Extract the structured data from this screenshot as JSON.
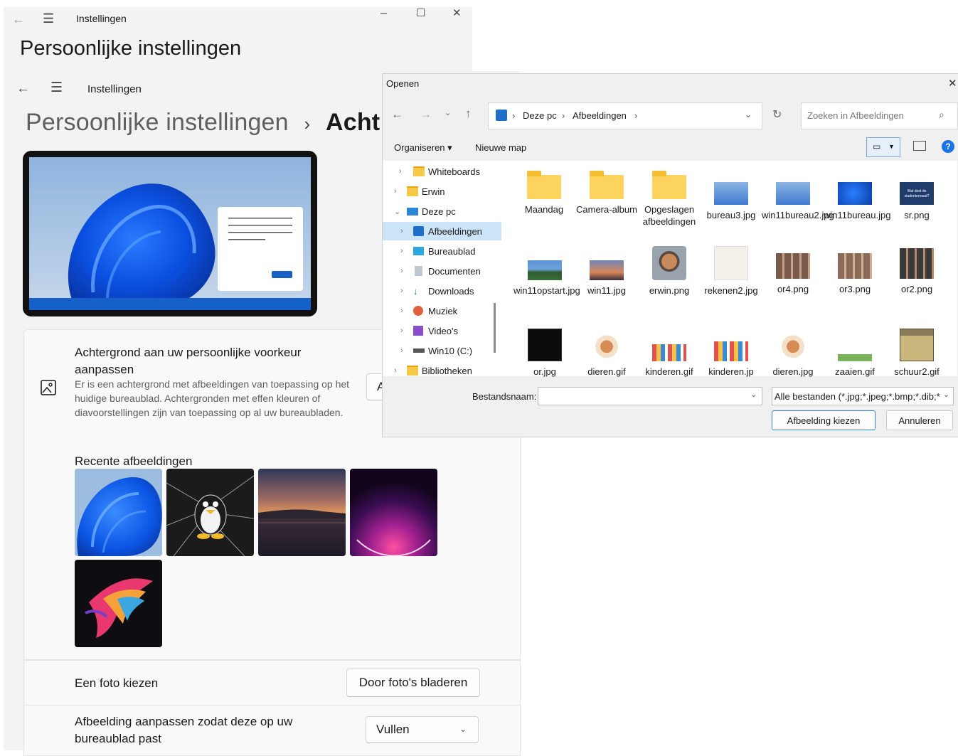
{
  "back_window": {
    "title": "Instellingen",
    "heading": "Persoonlijke instellingen",
    "controls": {
      "minimize": "–",
      "maximize": "☐",
      "close": "✕"
    }
  },
  "main_window": {
    "title": "Instellingen",
    "breadcrumb_parent": "Persoonlijke instellingen",
    "breadcrumb_sep": "›",
    "breadcrumb_current": "Acht",
    "background_card": {
      "title": "Achtergrond aan uw persoonlijke voorkeur aanpassen",
      "description": "Er is een achtergrond met afbeeldingen van toepassing op het huidige bureaublad. Achtergronden met effen kleuren of diavoorstellingen zijn van toepassing op al uw bureaubladen.",
      "dropdown_partial": "A"
    },
    "recent": {
      "title": "Recente afbeeldingen",
      "count": 5
    },
    "choose_photo": {
      "label": "Een foto kiezen",
      "button": "Door foto's bladeren"
    },
    "fit": {
      "label": "Afbeelding aanpassen zodat deze op uw bureaublad past",
      "value": "Vullen"
    }
  },
  "dialog": {
    "title": "Openen",
    "close": "✕",
    "breadcrumb": [
      "Deze pc",
      "Afbeeldingen"
    ],
    "search_placeholder": "Zoeken in Afbeeldingen",
    "toolbar": {
      "organize": "Organiseren ▾",
      "new_folder": "Nieuwe map"
    },
    "tree": [
      {
        "label": "Whiteboards",
        "icon": "folder-icon"
      },
      {
        "label": "Erwin",
        "icon": "folder-icon"
      },
      {
        "label": "Deze pc",
        "icon": "computer-icon"
      },
      {
        "label": "Afbeeldingen",
        "icon": "pictures-icon"
      },
      {
        "label": "Bureaublad",
        "icon": "desktop-icon"
      },
      {
        "label": "Documenten",
        "icon": "documents-icon"
      },
      {
        "label": "Downloads",
        "icon": "download-icon"
      },
      {
        "label": "Muziek",
        "icon": "music-icon"
      },
      {
        "label": "Video's",
        "icon": "video-icon"
      },
      {
        "label": "Win10 (C:)",
        "icon": "drive-icon"
      },
      {
        "label": "Bibliotheken",
        "icon": "folder-icon"
      }
    ],
    "files": [
      {
        "name": "Maandag",
        "kind": "folder"
      },
      {
        "name": "Camera-album",
        "kind": "folder"
      },
      {
        "name": "Opgeslagen afbeeldingen",
        "kind": "folder"
      },
      {
        "name": "bureau3.jpg",
        "kind": "image"
      },
      {
        "name": "win11bureau2.jpg",
        "kind": "image"
      },
      {
        "name": "win11bureau.jpg",
        "kind": "image"
      },
      {
        "name": "sr.png",
        "kind": "image"
      },
      {
        "name": "win11opstart.jpg",
        "kind": "image"
      },
      {
        "name": "win11.jpg",
        "kind": "image"
      },
      {
        "name": "erwin.png",
        "kind": "image"
      },
      {
        "name": "rekenen2.jpg",
        "kind": "image"
      },
      {
        "name": "or4.png",
        "kind": "image"
      },
      {
        "name": "or3.png",
        "kind": "image"
      },
      {
        "name": "or2.png",
        "kind": "image"
      },
      {
        "name": "or.jpg",
        "kind": "image"
      },
      {
        "name": "dieren.gif",
        "kind": "image"
      },
      {
        "name": "kinderen.gif",
        "kind": "image"
      },
      {
        "name": "kinderen.jp",
        "kind": "image"
      },
      {
        "name": "dieren.jpg",
        "kind": "image"
      },
      {
        "name": "zaaien.gif",
        "kind": "image"
      },
      {
        "name": "schuur2.gif",
        "kind": "image"
      }
    ],
    "sr_thumb_text": "Wat doet de studentenraad?",
    "filename_label": "Bestandsnaam:",
    "filename_value": "",
    "filter": "Alle bestanden (*.jpg;*.jpeg;*.bmp;*.dib;*",
    "ok_button": "Afbeelding kiezen",
    "cancel_button": "Annuleren"
  }
}
